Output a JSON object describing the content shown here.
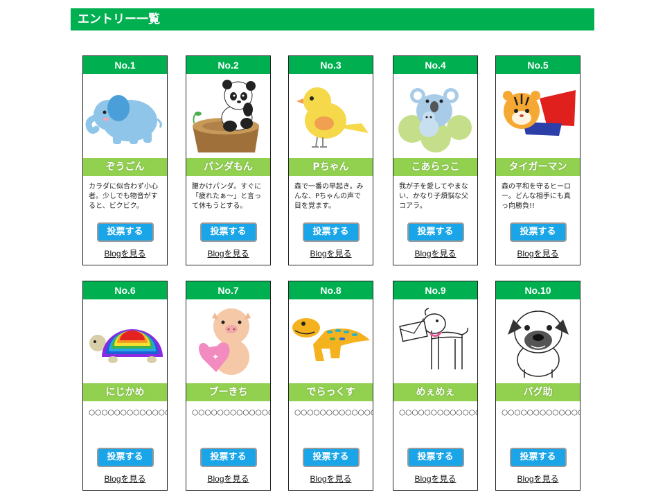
{
  "page": {
    "title": "エントリー一覧"
  },
  "cards": [
    {
      "no": "No.1",
      "name": "ぞうごん",
      "desc": "カラダに似合わず小心者。少しでも物音がすると、ビクビク。",
      "vote": "投票する",
      "blog": "Blogを見る",
      "icon": "elephant-icon"
    },
    {
      "no": "No.2",
      "name": "パンダもん",
      "desc": "腰かけパンダ。すぐに「疲れたぁ～」と言って休もうとする。",
      "vote": "投票する",
      "blog": "Blogを見る",
      "icon": "panda-icon"
    },
    {
      "no": "No.3",
      "name": "Pちゃん",
      "desc": "森で一番の早起き。みんな、Pちゃんの声で目を覚ます。",
      "vote": "投票する",
      "blog": "Blogを見る",
      "icon": "chick-icon"
    },
    {
      "no": "No.4",
      "name": "こあらっこ",
      "desc": "我が子を愛してやまない、かなり子煩悩な父コアラ。",
      "vote": "投票する",
      "blog": "Blogを見る",
      "icon": "koala-icon"
    },
    {
      "no": "No.5",
      "name": "タイガーマン",
      "desc": "森の平和を守るヒーロー。どんな相手にも真っ向勝負!!",
      "vote": "投票する",
      "blog": "Blogを見る",
      "icon": "tiger-icon"
    },
    {
      "no": "No.6",
      "name": "にじかめ",
      "desc": "○○○○○○○○○○○○○○○○○○○○○○○○",
      "vote": "投票する",
      "blog": "Blogを見る",
      "icon": "rainbow-turtle-icon"
    },
    {
      "no": "No.7",
      "name": "ブーきち",
      "desc": "○○○○○○○○○○○○○○○○○○○○○○○○",
      "vote": "投票する",
      "blog": "Blogを見る",
      "icon": "pig-icon"
    },
    {
      "no": "No.8",
      "name": "でらっくす",
      "desc": "○○○○○○○○○○○○○○○○○○○○○○○○",
      "vote": "投票する",
      "blog": "Blogを見る",
      "icon": "dinosaur-icon"
    },
    {
      "no": "No.9",
      "name": "めぇめぇ",
      "desc": "○○○○○○○○○○○○○○○○○○○○○○○○",
      "vote": "投票する",
      "blog": "Blogを見る",
      "icon": "goat-icon"
    },
    {
      "no": "No.10",
      "name": "バグ助",
      "desc": "○○○○○○○○○○○○○○○○○○○○○○○○",
      "vote": "投票する",
      "blog": "Blogを見る",
      "icon": "pug-icon"
    }
  ],
  "colors": {
    "header": "#00b050",
    "name_bar": "#92d050",
    "vote_button": "#1aa5e8"
  }
}
